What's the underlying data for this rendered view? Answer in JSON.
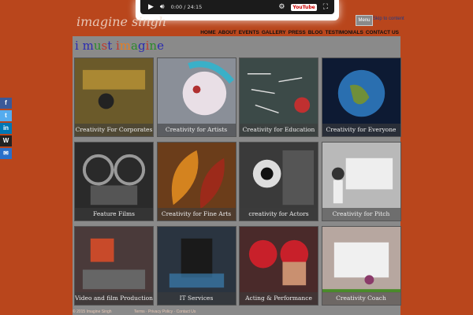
{
  "video": {
    "time": "0:00 / 24:15",
    "play_icon": "play-icon",
    "volume_icon": "volume-icon",
    "settings_icon": "gear-icon",
    "youtube_label": "YouTube",
    "fullscreen_icon": "fullscreen-icon"
  },
  "header": {
    "logo": "imagine singh",
    "menu_button": "Menu",
    "skip_link": "Skip to content"
  },
  "nav": [
    "HOME",
    "ABOUT",
    "EVENTS",
    "GALLERY",
    "PRESS",
    "BLOG",
    "TESTIMONIALS",
    "CONTACT US"
  ],
  "tagline": {
    "letters": [
      {
        "t": "i ",
        "c": "#2b2bb0"
      },
      {
        "t": "m",
        "c": "#2b2bb0"
      },
      {
        "t": "u",
        "c": "#2b8a2b"
      },
      {
        "t": "s",
        "c": "#c0392b"
      },
      {
        "t": "t ",
        "c": "#2b2bb0"
      },
      {
        "t": "i",
        "c": "#c0392b"
      },
      {
        "t": "m",
        "c": "#e67e22"
      },
      {
        "t": "a",
        "c": "#2b8a2b"
      },
      {
        "t": "g",
        "c": "#2b2bb0"
      },
      {
        "t": "i",
        "c": "#c0392b"
      },
      {
        "t": "n",
        "c": "#2b8a2b"
      },
      {
        "t": "e",
        "c": "#2b2bb0"
      }
    ]
  },
  "tiles": [
    {
      "caption": "Creativity For Corporates",
      "bg": "#6b5a2a"
    },
    {
      "caption": "Creativity for Artists",
      "bg": "#8a8f98"
    },
    {
      "caption": "Creativity for Education",
      "bg": "#3c4a48"
    },
    {
      "caption": "Creativity for Everyone",
      "bg": "#0d1a33"
    },
    {
      "caption": "Feature Films",
      "bg": "#2a2a2a"
    },
    {
      "caption": "Creativity for Fine Arts",
      "bg": "#6b3d1a"
    },
    {
      "caption": "creativity for Actors",
      "bg": "#3a3a3a"
    },
    {
      "caption": "Creativity  for Pitch",
      "bg": "#b9b9b9"
    },
    {
      "caption": "Video and film Production",
      "bg": "#4a3a3a"
    },
    {
      "caption": "IT Services",
      "bg": "#2a3440"
    },
    {
      "caption": "Acting & Performance",
      "bg": "#4a2a2a"
    },
    {
      "caption": "Creativity Coach",
      "bg": "#b7a7a0"
    }
  ],
  "social": [
    {
      "label": "f",
      "color": "#3b5998",
      "icon": "facebook-icon"
    },
    {
      "label": "t",
      "color": "#55acee",
      "icon": "twitter-icon"
    },
    {
      "label": "in",
      "color": "#0077b5",
      "icon": "linkedin-icon"
    },
    {
      "label": "W",
      "color": "#222222",
      "icon": "wikipedia-icon"
    },
    {
      "label": "✉",
      "color": "#2a6fc9",
      "icon": "email-icon"
    }
  ],
  "footer": {
    "copyright": "© 2015 Imagine Singh",
    "links": "Terms · Privacy Policy · Contact Us"
  }
}
